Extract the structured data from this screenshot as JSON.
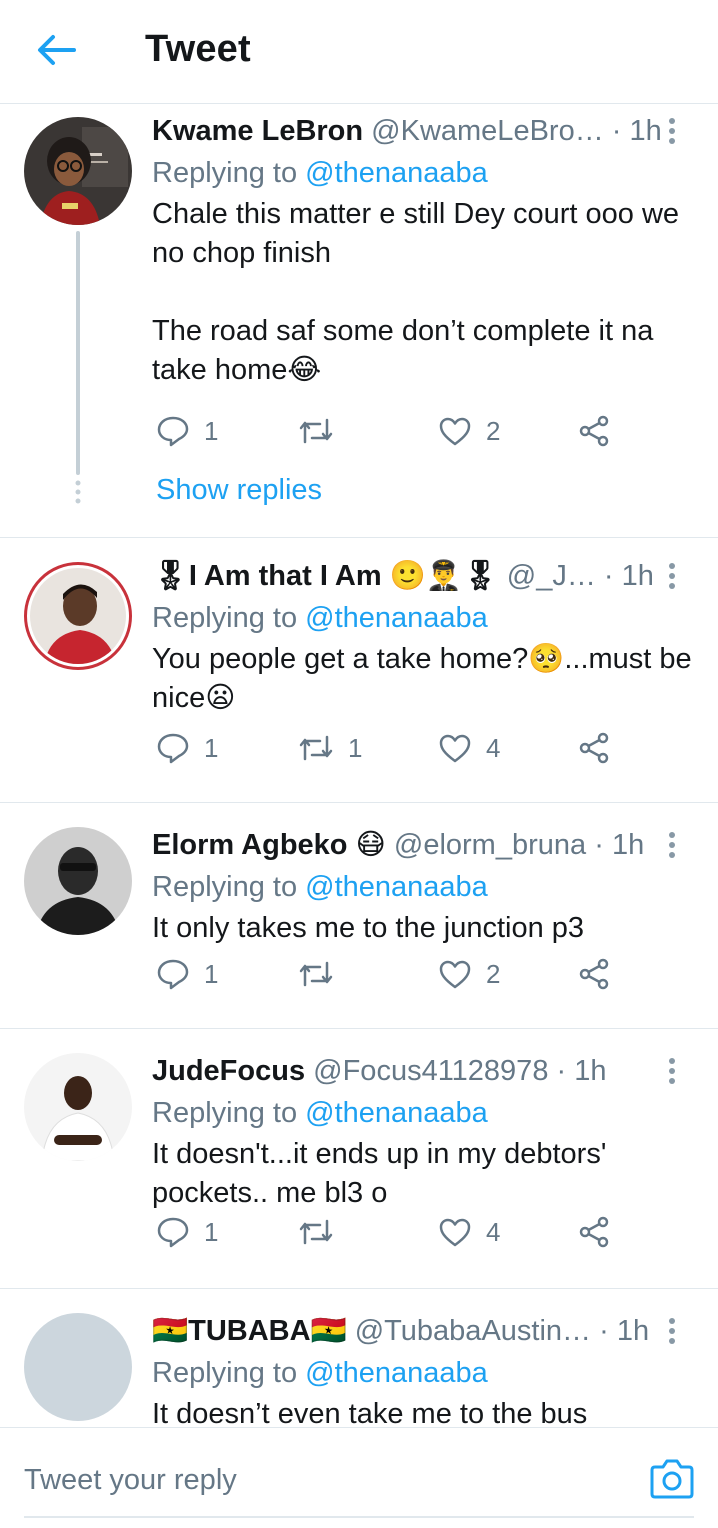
{
  "header": {
    "title": "Tweet",
    "back_icon": "arrow-left-icon"
  },
  "colors": {
    "accent": "#1da1f2",
    "secondary_text": "#657786",
    "primary_text": "#14171a",
    "divider": "#e1e8ed"
  },
  "tweets": [
    {
      "name": "Kwame LeBron",
      "handle": "@KwameLeBro…",
      "time": "1h",
      "replying_prefix": "Replying to",
      "replying_to": "@thenanaaba",
      "text1": "Chale this matter e still Dey court ooo we no chop finish",
      "text2": "The road saf some don’t complete it na take home😂",
      "replies": "1",
      "retweets": "",
      "likes": "2",
      "show_replies": "Show replies"
    },
    {
      "name": "🎖I Am that I Am 🙂👨‍✈️🎖",
      "handle": "@_J…",
      "time": "1h",
      "replying_prefix": "Replying to",
      "replying_to": "@thenanaaba",
      "text1": "You people get a take home?🥺...must be nice😦",
      "replies": "1",
      "retweets": "1",
      "likes": "4"
    },
    {
      "name": "Elorm Agbeko 😷",
      "handle": "@elorm_bruna",
      "time": "1h",
      "replying_prefix": "Replying to",
      "replying_to": "@thenanaaba",
      "text1": "It only takes me to the junction p3",
      "replies": "1",
      "retweets": "",
      "likes": "2"
    },
    {
      "name": "JudeFocus",
      "handle": "@Focus41128978",
      "time": "1h",
      "replying_prefix": "Replying to",
      "replying_to": "@thenanaaba",
      "text1": "It doesn't...it ends up in my debtors' pockets.. me bl3 o",
      "replies": "1",
      "retweets": "",
      "likes": "4"
    },
    {
      "name": "🇬🇭TUBABA🇬🇭",
      "handle": "@TubabaAustin…",
      "time": "1h",
      "replying_prefix": "Replying to",
      "replying_to": "@thenanaaba",
      "text1": "It doesn’t even take me to the bus"
    }
  ],
  "compose": {
    "placeholder": "Tweet your reply",
    "camera_icon": "camera-icon"
  },
  "separator": "·"
}
